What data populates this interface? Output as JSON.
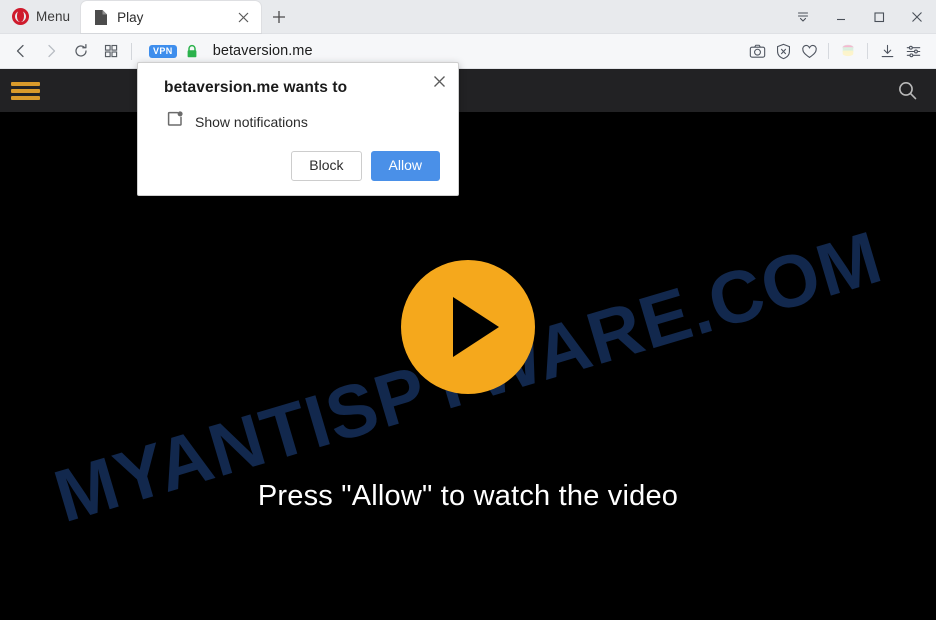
{
  "browser": {
    "name": "Opera",
    "menu_label": "Menu",
    "tabs": [
      {
        "title": "Play",
        "favicon": "page-icon",
        "active": true
      }
    ],
    "new_tab_label": "+",
    "window_controls": [
      {
        "name": "tab-list-icon",
        "label": "Tab list"
      },
      {
        "name": "minimize-icon",
        "label": "Minimize"
      },
      {
        "name": "maximize-icon",
        "label": "Maximize"
      },
      {
        "name": "close-icon",
        "label": "Close"
      }
    ],
    "nav": {
      "back": "Back",
      "forward": "Forward",
      "reload": "Reload",
      "speeddial": "Speed Dial"
    },
    "address": {
      "vpn_badge": "VPN",
      "security": "secure-lock",
      "url": "betaversion.me"
    },
    "omnibox_actions": [
      {
        "name": "snapshot-icon",
        "label": "Snapshot"
      },
      {
        "name": "adblock-shield-icon",
        "label": "Ad blocker"
      },
      {
        "name": "heart-icon",
        "label": "Add to favorites"
      },
      {
        "name": "workspace-stack-icon",
        "label": "Workspaces"
      },
      {
        "name": "download-icon",
        "label": "Downloads"
      },
      {
        "name": "easy-setup-icon",
        "label": "Easy setup"
      }
    ]
  },
  "site": {
    "header": {
      "menu_icon": "hamburger-icon",
      "search_icon": "search-icon"
    },
    "watermark": "MYANTISPYWARE.COM",
    "play_button_label": "Play video",
    "cta_text": "Press \"Allow\" to watch the video"
  },
  "dialog": {
    "title": "betaversion.me wants to",
    "permission_icon": "notification-icon",
    "permission_label": "Show notifications",
    "block_label": "Block",
    "allow_label": "Allow",
    "close_label": "Close"
  },
  "colors": {
    "accent_orange": "#f5a81c",
    "allow_blue": "#4a90e8",
    "opera_red": "#cf1b2d",
    "vpn_blue": "#3e8eed",
    "lock_green": "#2bb24c",
    "watermark_navy": "#12284d",
    "site_header": "#222224",
    "hamburger_gold": "#d99a2b"
  }
}
